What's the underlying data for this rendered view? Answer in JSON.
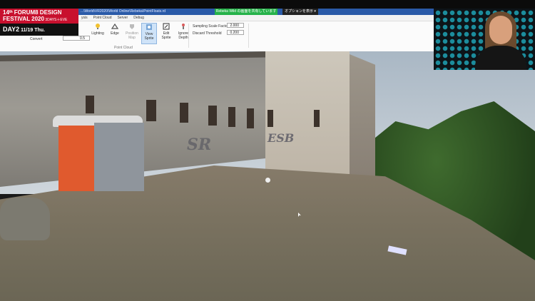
{
  "badge": {
    "line1": "14ᵗʰ FORUM8 DESIGN",
    "line2_main": "FESTIVAL 2020",
    "line2_small": " 3DAYS＋EVE",
    "line3_main": "DAY2",
    "line3_date": " 11/19 Thu."
  },
  "window": {
    "title_path": "...\\World\\VR2020\\World Online\\Rebeka\\PointFloats.rd",
    "share_banner": "Rebeka Wild の画面を共有しています",
    "options_button": "オプションを表示 ▾"
  },
  "menu": {
    "items": [
      "ysis",
      "Point Cloud",
      "Server",
      "Debug"
    ]
  },
  "ribbon": {
    "buttons": [
      {
        "label": "Lighting",
        "icon": "lightbulb-icon"
      },
      {
        "label": "Edge",
        "icon": "edge-icon"
      },
      {
        "label": "Position\nMap",
        "icon": "position-map-icon"
      },
      {
        "label": "View\nSprite",
        "icon": "view-sprite-icon"
      },
      {
        "label": "Edit\nSprite",
        "icon": "edit-sprite-icon"
      },
      {
        "label": "Ignore\nDepth",
        "icon": "ignore-depth-icon"
      }
    ],
    "convert_label": "Convert",
    "convert_value": "0.5",
    "group_label": "Point Cloud",
    "sampling_label": "Sampling Scale Factor",
    "sampling_value": "2.000",
    "discard_label": "Discard Threshold",
    "discard_value": "0.200"
  },
  "colors": {
    "badge_red": "#c8102e",
    "titlebar_blue": "#2a5aa8",
    "share_green": "#26b24a",
    "active_button": "#cfe3f8"
  },
  "scene": {
    "graffiti_tags": [
      "ESB",
      "SR"
    ]
  }
}
